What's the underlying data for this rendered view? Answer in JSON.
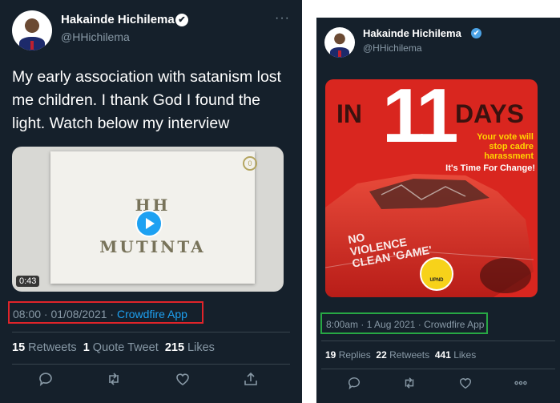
{
  "left_tweet": {
    "author_name": "Hakainde Hichilema",
    "author_handle": "@HHichilema",
    "verified_glyph": "✔",
    "more_glyph": "···",
    "text": "My early association with satanism lost me children. I thank God I found the light. Watch below my interview",
    "video": {
      "title_line1": "HH",
      "title_line2": "MUTINTA",
      "duration": "0:43",
      "logo_glyph": "0"
    },
    "meta": {
      "time_date": "08:00 · 01/08/2021 · ",
      "source": "Crowdfire App",
      "highlight_color": "#e0242a"
    },
    "stats": {
      "retweets_count": "15",
      "retweets_label": "Retweets",
      "quotes_count": "1",
      "quotes_label": "Quote Tweet",
      "likes_count": "215",
      "likes_label": "Likes"
    },
    "actions": [
      "reply-icon",
      "retweet-icon",
      "like-icon",
      "share-icon"
    ]
  },
  "right_tweet": {
    "author_name": "Hakainde Hichilema",
    "author_handle": "@HHichilema",
    "verified_glyph": "✔",
    "poster": {
      "in": "IN",
      "number": "11",
      "days": "DAYS",
      "vote_line1": "Your vote will",
      "vote_line2": "stop cadre",
      "vote_line3": "harassment",
      "slogan": "It's Time For Change!",
      "graffiti_line1": "NO",
      "graffiti_line2": "VIOLENCE",
      "graffiti_line3": "CLEAN 'GAME'",
      "badge_label": "UPND"
    },
    "meta": {
      "time_date_source": "8:00am · 1 Aug 2021 · Crowdfire App",
      "highlight_color": "#27a744"
    },
    "stats": {
      "replies_count": "19",
      "replies_label": "Replies",
      "retweets_count": "22",
      "retweets_label": "Retweets",
      "likes_count": "441",
      "likes_label": "Likes"
    },
    "actions": [
      "reply-icon",
      "retweet-icon",
      "like-icon",
      "more-icon"
    ]
  },
  "colors": {
    "background": "#15202b",
    "accent": "#1da1f2",
    "muted": "#8899a6"
  }
}
